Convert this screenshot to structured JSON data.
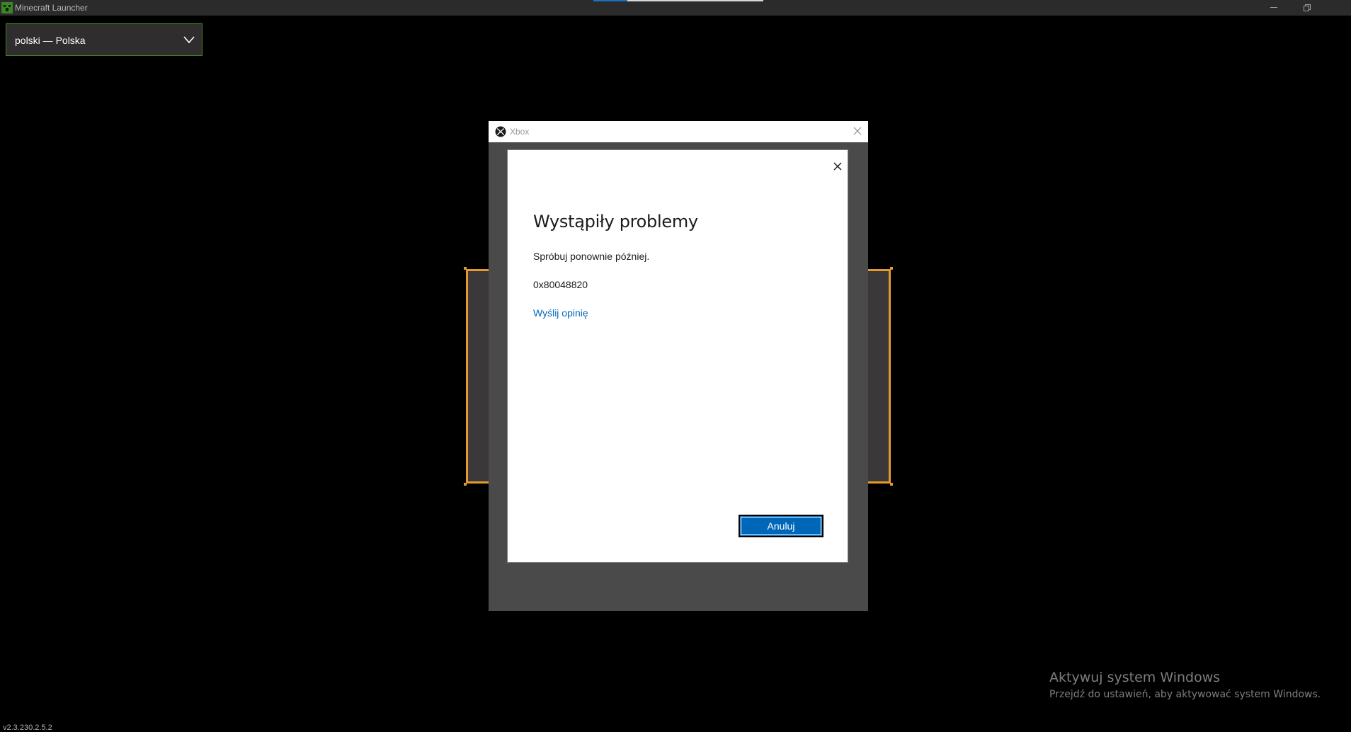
{
  "window": {
    "title": "Minecraft Launcher",
    "colors": {
      "titlebar": "#2b2b2b",
      "accent_green": "#3c8527",
      "frame_orange": "#e59a2e"
    }
  },
  "language_select": {
    "value": "polski — Polska",
    "icon": "chevron-down-icon"
  },
  "xbox_window": {
    "title": "Xbox",
    "icon": "xbox-logo-icon"
  },
  "dialog": {
    "heading": "Wystąpiły problemy",
    "message": "Spróbuj ponownie później.",
    "error_code": "0x80048820",
    "feedback_link": "Wyślij opinię",
    "cancel_label": "Anuluj",
    "link_color": "#0067b8",
    "button_color": "#0067b8"
  },
  "watermark": {
    "title": "Aktywuj system Windows",
    "subtitle": "Przejdź do ustawień, aby aktywować system Windows."
  },
  "footer": {
    "version": "v2.3.230.2.5.2"
  }
}
